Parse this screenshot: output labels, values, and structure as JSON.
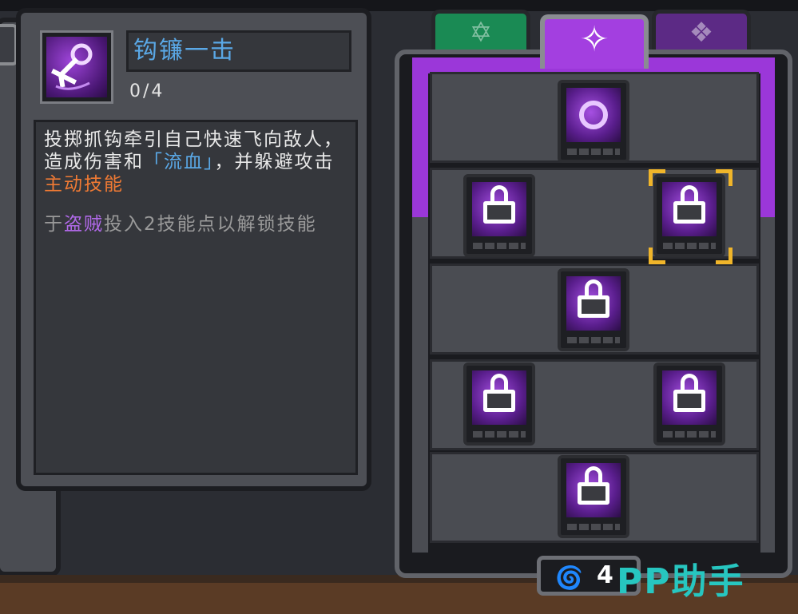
{
  "skill": {
    "name": "钩镰一击",
    "level": "0/4",
    "icon": "grapple-hook-icon",
    "description_part1": "投掷抓钩牵引自己快速飞向敌人，造成伤害和",
    "description_keyword": "「流血」",
    "description_part2": "，并躲避攻击",
    "type_label": "主动技能",
    "requirement_part1": "于",
    "requirement_class": "盗贼",
    "requirement_part2": "投入2技能点以解锁技能"
  },
  "tabs": [
    {
      "icon": "star-icon",
      "color": "#1a8a54",
      "selected": false
    },
    {
      "icon": "diamond-compass-icon",
      "color": "#a33fe0",
      "selected": true
    },
    {
      "icon": "emblem-icon",
      "color": "#5c2a85",
      "selected": false
    }
  ],
  "skill_points": {
    "icon": "swirl-icon",
    "value": "4"
  },
  "watermark": "PP助手",
  "colors": {
    "accent_purple": "#9b37d9",
    "highlight_blue": "#5aa8e6",
    "active_orange": "#f07a34",
    "select_gold": "#f0b52a"
  }
}
